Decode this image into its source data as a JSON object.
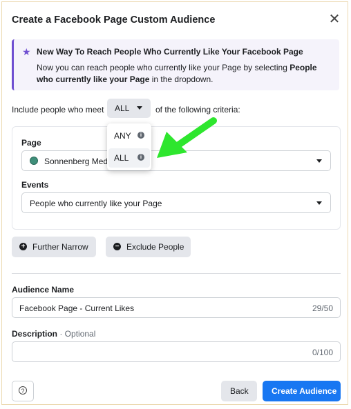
{
  "dialog": {
    "title": "Create a Facebook Page Custom Audience",
    "close_icon": "close-icon"
  },
  "notice": {
    "title": "New Way To Reach People Who Currently Like Your Facebook Page",
    "body_prefix": "Now you can reach people who currently like your Page by selecting ",
    "body_bold": "People who currently like your Page",
    "body_suffix": " in the dropdown.",
    "accent": "#6f4fd1"
  },
  "criteria": {
    "prefix": "Include people who meet",
    "selected": "ALL",
    "suffix": "of the following criteria:"
  },
  "dropdown": {
    "options": [
      "ANY",
      "ALL"
    ],
    "selected": "ALL"
  },
  "page_field": {
    "label": "Page",
    "value": "Sonnenberg Medi"
  },
  "events_field": {
    "label": "Events",
    "value": "People who currently like your Page"
  },
  "actions": {
    "narrow": "Further Narrow",
    "exclude": "Exclude People"
  },
  "audience_name": {
    "label": "Audience Name",
    "value": "Facebook Page - Current Likes",
    "count": "29/50"
  },
  "description": {
    "label": "Description",
    "optional": " · Optional",
    "value": "",
    "count": "0/100"
  },
  "footer": {
    "back": "Back",
    "create": "Create Audience",
    "help_icon": "help-icon"
  },
  "colors": {
    "primary": "#1877f2",
    "arrow": "#2ee62e"
  }
}
